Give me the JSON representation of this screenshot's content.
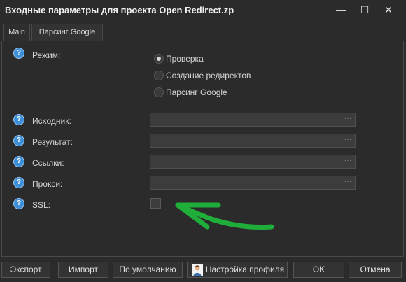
{
  "window": {
    "title": "Входные параметры для проекта Open Redirect.zp",
    "minimize_icon": "minimize-icon",
    "maximize_icon": "maximize-icon",
    "close_icon": "close-icon"
  },
  "tabs": [
    {
      "label": "Main",
      "active": true
    },
    {
      "label": "Парсинг Google",
      "active": false
    }
  ],
  "help_glyph": "?",
  "mode": {
    "label": "Режим:",
    "options": [
      {
        "label": "Проверка",
        "checked": true
      },
      {
        "label": "Создание редиректов",
        "checked": false
      },
      {
        "label": "Парсинг Google",
        "checked": false
      }
    ]
  },
  "fields": [
    {
      "label": "Исходник:",
      "value": "",
      "browse": "···"
    },
    {
      "label": "Результат:",
      "value": "",
      "browse": "···"
    },
    {
      "label": "Ссылки:",
      "value": "",
      "browse": "···"
    },
    {
      "label": "Прокси:",
      "value": "",
      "browse": "···"
    }
  ],
  "ssl": {
    "label": "SSL:",
    "checked": false
  },
  "buttons": {
    "export": "Экспорт",
    "import": "Импорт",
    "defaults": "По умолчанию",
    "profile": "Настройка профиля",
    "ok": "OK",
    "cancel": "Отмена"
  },
  "colors": {
    "background": "#2b2b2b",
    "help_icon": "#3d8fd8",
    "annotation_arrow": "#1fae3a"
  }
}
